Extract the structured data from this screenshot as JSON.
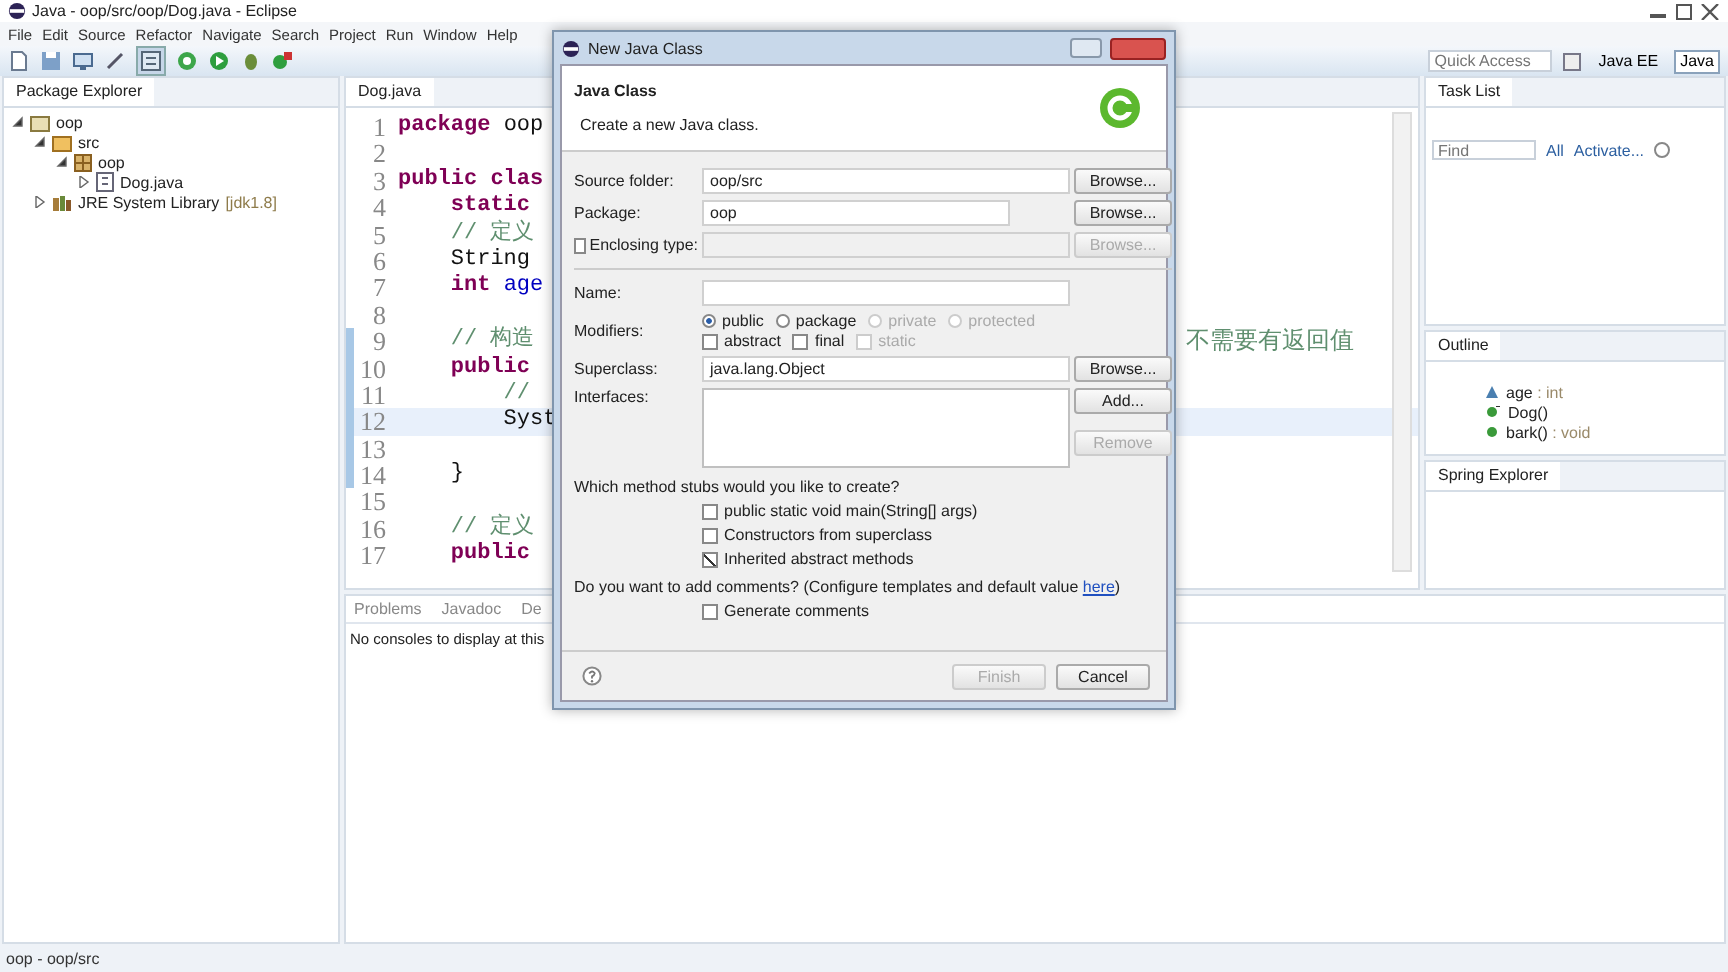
{
  "window": {
    "title": "Java - oop/src/oop/Dog.java - Eclipse"
  },
  "menu": [
    "File",
    "Edit",
    "Source",
    "Refactor",
    "Navigate",
    "Search",
    "Project",
    "Run",
    "Window",
    "Help"
  ],
  "quick_access": {
    "placeholder": "Quick Access"
  },
  "perspectives": [
    {
      "label": "Java EE",
      "selected": false
    },
    {
      "label": "Java",
      "selected": true
    }
  ],
  "package_explorer": {
    "title": "Package Explorer",
    "tree": [
      {
        "label": "oop",
        "kind": "project",
        "expanded": true,
        "children": [
          {
            "label": "src",
            "kind": "folder",
            "expanded": true,
            "children": [
              {
                "label": "oop",
                "kind": "package",
                "expanded": true,
                "children": [
                  {
                    "label": "Dog.java",
                    "kind": "file",
                    "expanded": false
                  }
                ]
              }
            ]
          },
          {
            "label": "JRE System Library",
            "decoration": "[jdk1.8]",
            "kind": "library",
            "expanded": false
          }
        ]
      }
    ]
  },
  "editor": {
    "tab": "Dog.java",
    "lines": [
      {
        "number": "1",
        "marked": false,
        "current": false,
        "segments": [
          {
            "text": "package",
            "kind": "keyword"
          },
          {
            "text": " oop",
            "kind": "plain"
          }
        ]
      },
      {
        "number": "2",
        "marked": false,
        "current": false
      },
      {
        "number": "3",
        "marked": false,
        "current": false,
        "segments": [
          {
            "text": "public clas",
            "kind": "keyword"
          }
        ]
      },
      {
        "number": "4",
        "marked": false,
        "current": false,
        "segments": [
          {
            "text": "    static",
            "kind": "keyword"
          }
        ]
      },
      {
        "number": "5",
        "marked": false,
        "current": false,
        "segments": [
          {
            "text": "    // 定义",
            "kind": "comment"
          }
        ]
      },
      {
        "number": "6",
        "marked": false,
        "current": false,
        "segments": [
          {
            "text": "    String",
            "kind": "plain"
          }
        ]
      },
      {
        "number": "7",
        "marked": false,
        "current": false,
        "segments": [
          {
            "text": "    int",
            "kind": "keyword"
          },
          {
            "text": " age",
            "kind": "field"
          }
        ]
      },
      {
        "number": "8",
        "marked": false,
        "current": false
      },
      {
        "number": "9",
        "marked": true,
        "current": false,
        "segments": [
          {
            "text": "    // 构造",
            "kind": "comment"
          }
        ],
        "tail": "不需要有返回值"
      },
      {
        "number": "10",
        "marked": true,
        "current": false,
        "segments": [
          {
            "text": "    public",
            "kind": "keyword"
          }
        ]
      },
      {
        "number": "11",
        "marked": true,
        "current": false,
        "segments": [
          {
            "text": "        //",
            "kind": "comment"
          }
        ]
      },
      {
        "number": "12",
        "marked": true,
        "current": true,
        "segments": [
          {
            "text": "        Syst",
            "kind": "plain"
          }
        ]
      },
      {
        "number": "13",
        "marked": true,
        "current": false
      },
      {
        "number": "14",
        "marked": true,
        "current": false,
        "segments": [
          {
            "text": "    }",
            "kind": "plain"
          }
        ]
      },
      {
        "number": "15",
        "marked": false,
        "current": false
      },
      {
        "number": "16",
        "marked": false,
        "current": false,
        "segments": [
          {
            "text": "    // 定义",
            "kind": "comment"
          }
        ]
      },
      {
        "number": "17",
        "marked": false,
        "current": false,
        "segments": [
          {
            "text": "    public",
            "kind": "keyword"
          }
        ]
      }
    ]
  },
  "console": {
    "tabs": [
      "Problems",
      "Javadoc",
      "De"
    ],
    "message": "No consoles to display at this"
  },
  "task_list": {
    "title": "Task List",
    "find": {
      "placeholder": "Find"
    },
    "links": [
      "All",
      "Activate..."
    ]
  },
  "outline": {
    "title": "Outline",
    "items": [
      {
        "name": "age",
        "type": " : int",
        "kind": "field"
      },
      {
        "name": "Dog()",
        "kind": "constructor"
      },
      {
        "name": "bark()",
        "type": " : void",
        "kind": "method"
      }
    ]
  },
  "spring_explorer": {
    "title": "Spring Explorer"
  },
  "status_bar": "oop - oop/src",
  "dialog": {
    "title": "New Java Class",
    "heading": "Java Class",
    "subtitle": "Create a new Java class.",
    "source_folder": {
      "label": "Source folder:",
      "value": "oop/src",
      "button": "Browse..."
    },
    "package": {
      "label": "Package:",
      "value": "oop",
      "button": "Browse..."
    },
    "enclosing": {
      "label": "Enclosing type:",
      "checked": false,
      "button": "Browse...",
      "disabled": true
    },
    "name": {
      "label": "Name:"
    },
    "modifiers": {
      "label": "Modifiers:",
      "radios": [
        {
          "label": "public",
          "selected": true,
          "disabled": false
        },
        {
          "label": "package",
          "selected": false,
          "disabled": false
        },
        {
          "label": "private",
          "selected": false,
          "disabled": true
        },
        {
          "label": "protected",
          "selected": false,
          "disabled": true
        }
      ],
      "checks": [
        {
          "label": "abstract",
          "checked": false,
          "disabled": false
        },
        {
          "label": "final",
          "checked": false,
          "disabled": false
        },
        {
          "label": "static",
          "checked": false,
          "disabled": true
        }
      ]
    },
    "superclass": {
      "label": "Superclass:",
      "value": "java.lang.Object",
      "button": "Browse..."
    },
    "interfaces": {
      "label": "Interfaces:",
      "buttons": [
        {
          "label": "Add...",
          "disabled": false
        },
        {
          "label": "Remove",
          "disabled": true
        }
      ]
    },
    "stubs_question": "Which method stubs would you like to create?",
    "stubs": [
      {
        "label": "public static void main(String[] args)",
        "checked": false
      },
      {
        "label": "Constructors from superclass",
        "checked": false
      },
      {
        "label": "Inherited abstract methods",
        "checked": true
      }
    ],
    "comments_question": "Do you want to add comments? (Configure templates and default value ",
    "comments_link": "here",
    "comments_end": ")",
    "generate_comments": {
      "label": "Generate comments",
      "checked": false
    },
    "buttons": [
      {
        "label": "Finish",
        "disabled": true
      },
      {
        "label": "Cancel",
        "disabled": false
      }
    ]
  }
}
